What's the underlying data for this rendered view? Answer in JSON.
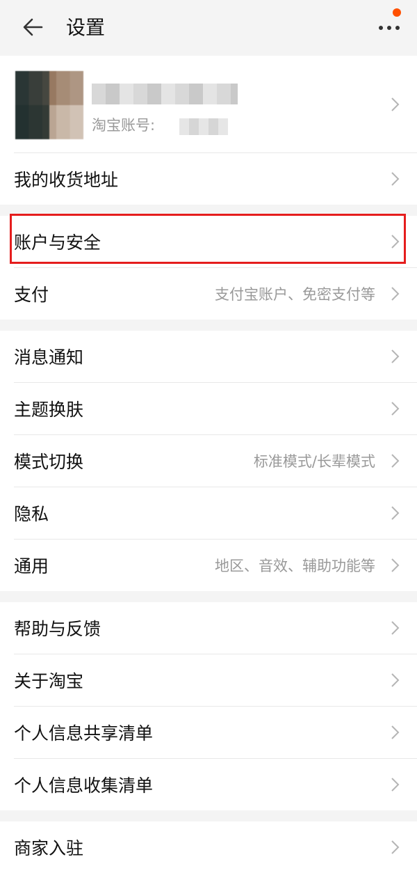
{
  "header": {
    "title": "设置",
    "back_icon": "arrow-left-icon",
    "more_icon": "more-dots-icon",
    "badge_color": "#ff5000"
  },
  "profile": {
    "name": "",
    "account_label": "淘宝账号:"
  },
  "groups": [
    {
      "items": [
        {
          "label": "我的收货地址",
          "value": ""
        }
      ]
    },
    {
      "items": [
        {
          "label": "账户与安全",
          "value": ""
        },
        {
          "label": "支付",
          "value": "支付宝账户、免密支付等"
        }
      ]
    },
    {
      "items": [
        {
          "label": "消息通知",
          "value": ""
        },
        {
          "label": "主题换肤",
          "value": ""
        },
        {
          "label": "模式切换",
          "value": "标准模式/长辈模式"
        },
        {
          "label": "隐私",
          "value": ""
        },
        {
          "label": "通用",
          "value": "地区、音效、辅助功能等"
        }
      ]
    },
    {
      "items": [
        {
          "label": "帮助与反馈",
          "value": ""
        },
        {
          "label": "关于淘宝",
          "value": ""
        },
        {
          "label": "个人信息共享清单",
          "value": ""
        },
        {
          "label": "个人信息收集清单",
          "value": ""
        }
      ]
    },
    {
      "items": [
        {
          "label": "商家入驻",
          "value": ""
        }
      ]
    }
  ],
  "highlight_color": "#e51d1d"
}
